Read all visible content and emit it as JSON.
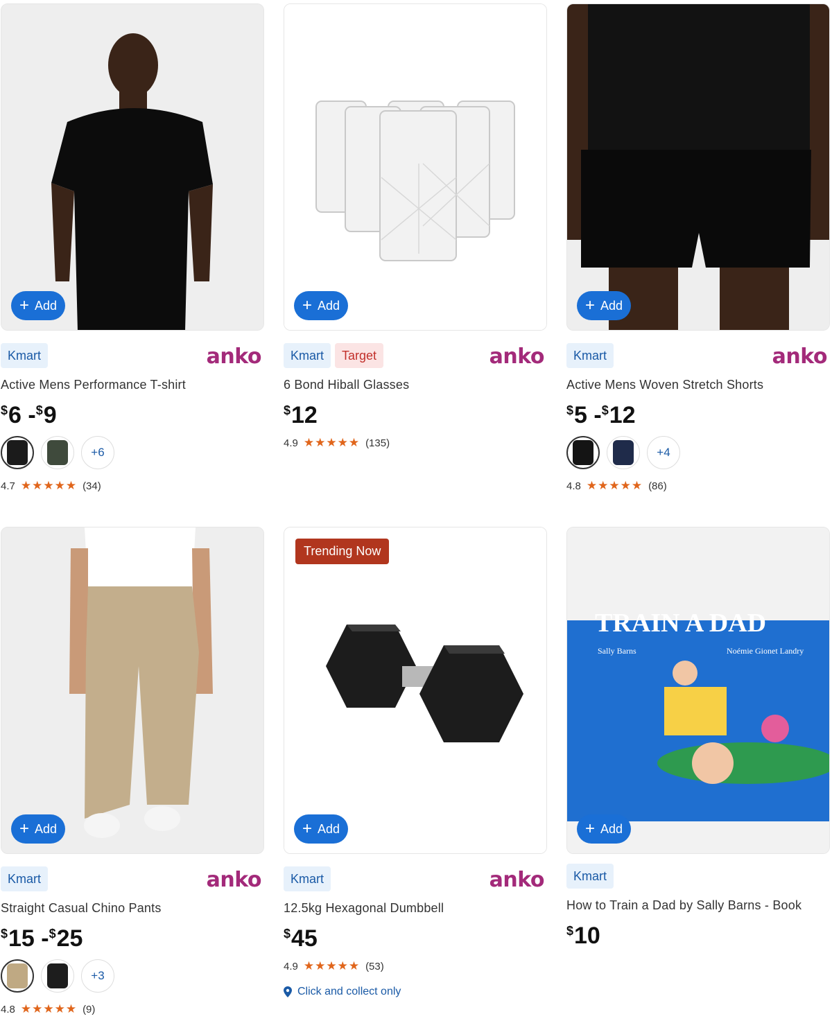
{
  "products": [
    {
      "add_label": "Add",
      "tags": [
        "Kmart"
      ],
      "brand": "anko",
      "title": "Active Mens Performance T-shirt",
      "price_main": "6 - ",
      "price_second": "9",
      "currency": "$",
      "swatch_more": "+6",
      "rating": "4.7",
      "stars": "★★★★★",
      "reviews": "(34)"
    },
    {
      "add_label": "Add",
      "tags": [
        "Kmart",
        "Target"
      ],
      "brand": "anko",
      "title": "6 Bond Hiball Glasses",
      "price_main": "12",
      "currency": "$",
      "rating": "4.9",
      "stars": "★★★★★",
      "reviews": "(135)"
    },
    {
      "add_label": "Add",
      "tags": [
        "Kmart"
      ],
      "brand": "anko",
      "title": "Active Mens Woven Stretch Shorts",
      "price_main": "5 - ",
      "price_second": "12",
      "currency": "$",
      "swatch_more": "+4",
      "rating": "4.8",
      "stars": "★★★★★",
      "reviews": "(86)"
    },
    {
      "add_label": "Add",
      "tags": [
        "Kmart"
      ],
      "brand": "anko",
      "title": "Straight Casual Chino Pants",
      "price_main": "15 - ",
      "price_second": "25",
      "currency": "$",
      "swatch_more": "+3",
      "rating": "4.8",
      "stars": "★★★★★",
      "reviews": "(9)"
    },
    {
      "add_label": "Add",
      "badge": "Trending Now",
      "tags": [
        "Kmart"
      ],
      "brand": "anko",
      "title": "12.5kg Hexagonal Dumbbell",
      "price_main": "45",
      "currency": "$",
      "rating": "4.9",
      "stars": "★★★★★",
      "reviews": "(53)",
      "collect": "Click and collect only"
    },
    {
      "add_label": "Add",
      "tags": [
        "Kmart"
      ],
      "title": "How to Train a Dad by Sally Barns - Book",
      "price_main": "10",
      "currency": "$",
      "book_author": "Sally Barns",
      "book_illustrator": "Noémie Gionet Landry",
      "book_title_partial": "TRAIN A DAD"
    }
  ],
  "colors": {
    "accent": "#1a6fd6",
    "brand_anko": "#a32a7a",
    "star": "#e0651b",
    "trend_badge": "#b1361e"
  }
}
